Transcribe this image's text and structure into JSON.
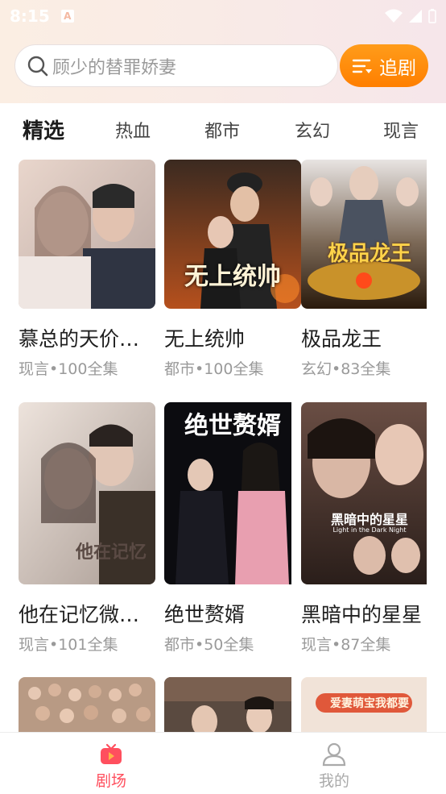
{
  "status_bar": {
    "time": "8:15",
    "notification_icon": "a-icon"
  },
  "search": {
    "placeholder": "顾少的替罪娇妻",
    "follow_button_label": "追剧"
  },
  "tabs": [
    {
      "label": "精选",
      "active": true
    },
    {
      "label": "热血",
      "active": false
    },
    {
      "label": "都市",
      "active": false
    },
    {
      "label": "玄幻",
      "active": false
    },
    {
      "label": "现言",
      "active": false
    }
  ],
  "dramas": [
    {
      "title": "慕总的天价…",
      "meta": "现言•100全集",
      "poster_text": ""
    },
    {
      "title": "无上统帅",
      "meta": "都市•100全集",
      "poster_text": "无上统帅"
    },
    {
      "title": "极品龙王",
      "meta": "玄幻•83全集",
      "poster_text": "极品龙王"
    },
    {
      "title": "他在记忆微…",
      "meta": "现言•101全集",
      "poster_text": "他在记忆"
    },
    {
      "title": "绝世赘婿",
      "meta": "都市•50全集",
      "poster_text": "绝世赘婿"
    },
    {
      "title": "黑暗中的星星",
      "meta": "现言•87全集",
      "poster_text": "黑暗中的星星",
      "poster_subtext": "Light in the Dark Night"
    },
    {
      "poster_text": ""
    },
    {
      "poster_text": ""
    },
    {
      "poster_text": "爱妻萌宝我都要"
    }
  ],
  "bottom_nav": [
    {
      "label": "剧场",
      "icon": "tv-icon",
      "active": true
    },
    {
      "label": "我的",
      "icon": "user-icon",
      "active": false
    }
  ],
  "colors": {
    "accent": "#ff8a00",
    "nav_active": "#ff4f5e",
    "nav_inactive": "#aaaaaa"
  }
}
